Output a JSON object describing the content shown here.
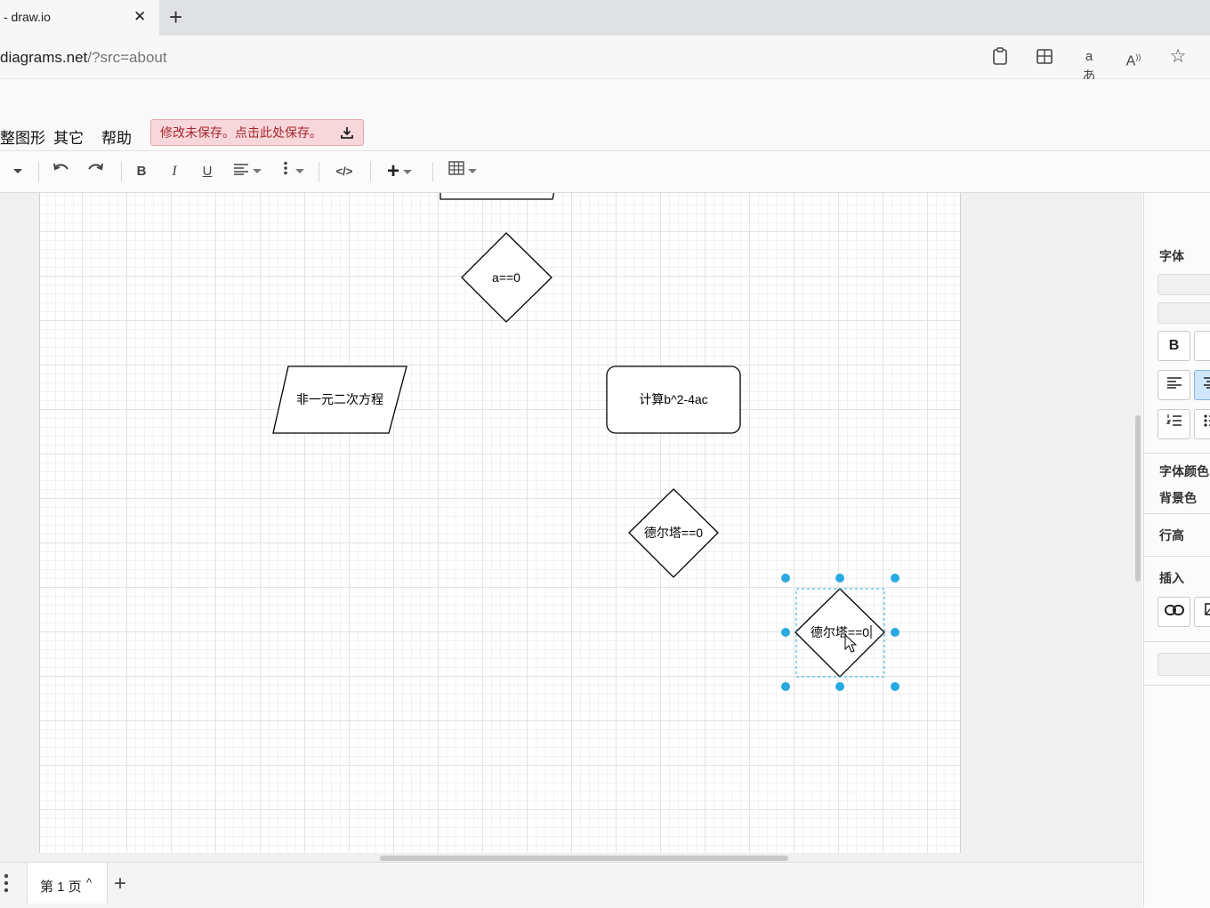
{
  "browser": {
    "tab_title": "- draw.io",
    "close_glyph": "✕",
    "new_tab_glyph": "+",
    "url_host": "diagrams.net",
    "url_path": "/?src=about",
    "icons": [
      "clipboard-icon",
      "split-screen-icon",
      "translate-icon",
      "read-aloud-icon",
      "favorite-star-icon"
    ]
  },
  "menubar": {
    "items": [
      "整图形",
      "其它",
      "帮助"
    ],
    "save_banner": "修改未保存。点击此处保存。",
    "save_banner_icon": "download-icon"
  },
  "toolbar": {
    "bold": "B",
    "italic": "I",
    "underline": "U",
    "html": "</>",
    "insert": "+"
  },
  "diagram": {
    "shapes": [
      {
        "type": "parallelogram",
        "label": ""
      },
      {
        "type": "rhombus",
        "label": "a==0"
      },
      {
        "type": "parallelogram",
        "label": "非一元二次方程"
      },
      {
        "type": "rounded-rectangle",
        "label": "计算b^2-4ac"
      },
      {
        "type": "rhombus",
        "label": "德尔塔==0"
      },
      {
        "type": "rhombus",
        "label": "德尔塔==0",
        "selected": true
      }
    ],
    "selection_color": "#29a9e1"
  },
  "pagebar": {
    "page_tab": "第 1 页",
    "page_tab_arrow": "^",
    "add_page": "+"
  },
  "format_panel": {
    "font_label": "字体",
    "bold_btn": "B",
    "font_color_label": "字体颜色",
    "background_label": "背景色",
    "line_height_label": "行高",
    "insert_label": "插入"
  }
}
